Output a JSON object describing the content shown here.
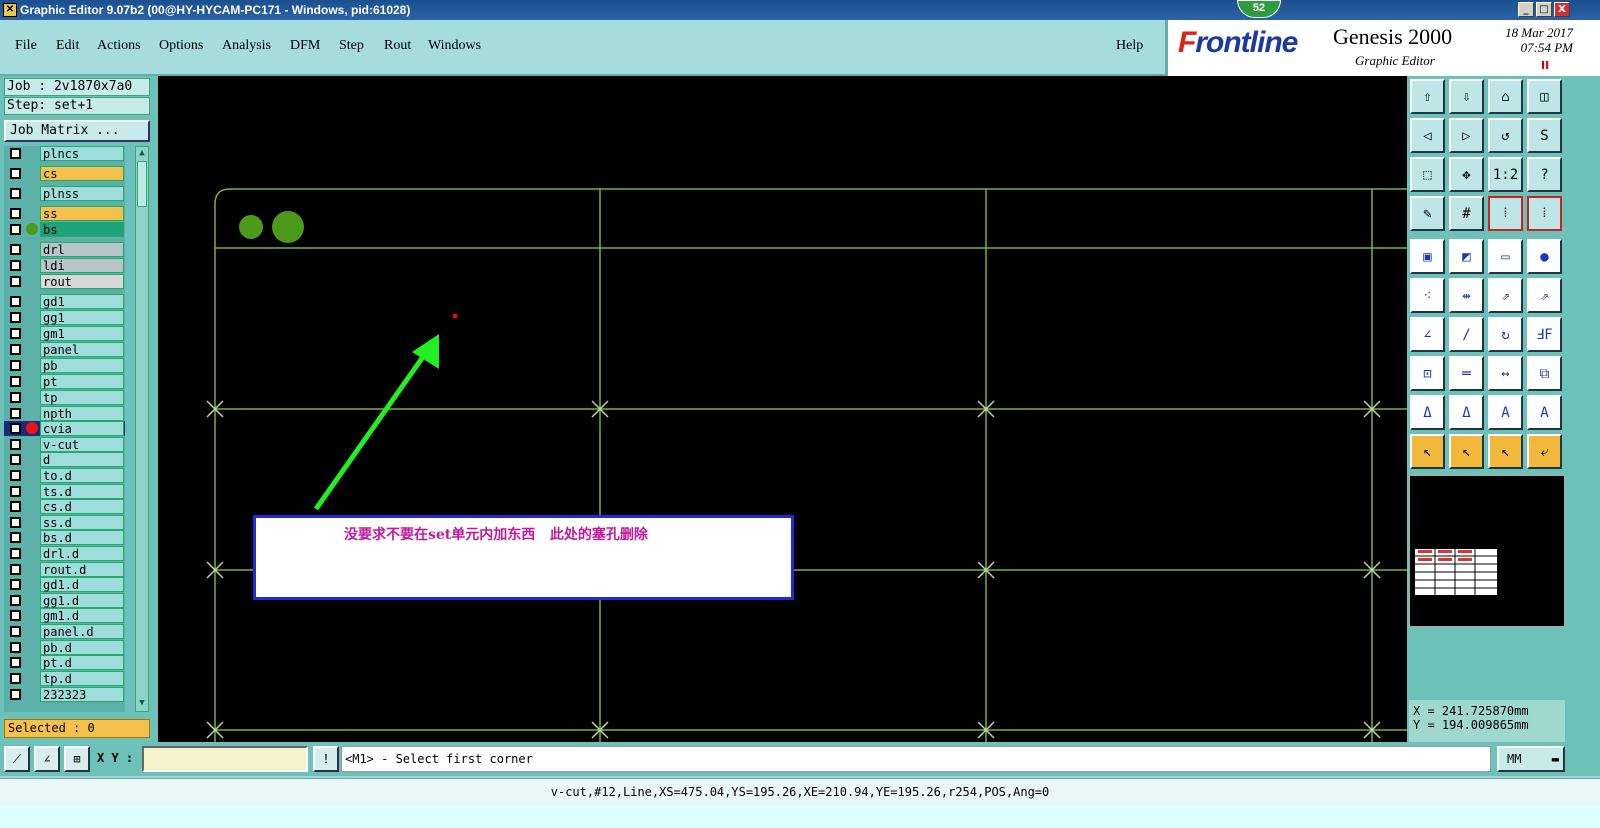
{
  "window": {
    "title": "Graphic Editor 9.07b2 (00@HY-HYCAM-PC171 - Windows, pid:61028)",
    "badge": "52",
    "controls": [
      "_",
      "□",
      "X"
    ]
  },
  "menu": {
    "items": [
      "File",
      "Edit",
      "Actions",
      "Options",
      "Analysis",
      "DFM",
      "Step",
      "Rout",
      "Windows"
    ],
    "help": "Help"
  },
  "brand": {
    "logo_f": "F",
    "logo_rest": "rontline",
    "product": "Genesis 2000",
    "subtitle": "Graphic Editor",
    "date": "18 Mar 2017",
    "time": "07:54 PM",
    "marker": "II"
  },
  "job": {
    "job_line": "Job : 2v1870x7a0",
    "step_line": "Step: set+1",
    "matrix_button": "Job Matrix ..."
  },
  "layers": [
    {
      "name": "plncs",
      "color": "#9fdcdc",
      "dot": null,
      "sel": false
    },
    {
      "name": "cs",
      "color": "#f6c04c",
      "dot": null,
      "sel": false
    },
    {
      "name": "plnss",
      "color": "#9fdcdc",
      "dot": null,
      "sel": false
    },
    {
      "name": "ss",
      "color": "#f6c04c",
      "dot": null,
      "sel": false
    },
    {
      "name": "bs",
      "color": "#1fa27a",
      "dot": "#4c9a1a",
      "sel": false
    },
    {
      "name": "drl",
      "color": "#b7c4c8",
      "dot": null,
      "sel": false
    },
    {
      "name": "ldi",
      "color": "#b7c4c8",
      "dot": null,
      "sel": false
    },
    {
      "name": "rout",
      "color": "#d8d8d8",
      "dot": null,
      "sel": false
    },
    {
      "name": "gd1",
      "color": "#9fdcdc",
      "dot": null,
      "sel": false
    },
    {
      "name": "gg1",
      "color": "#9fdcdc",
      "dot": null,
      "sel": false
    },
    {
      "name": "gm1",
      "color": "#9fdcdc",
      "dot": null,
      "sel": false
    },
    {
      "name": "panel",
      "color": "#9fdcdc",
      "dot": null,
      "sel": false
    },
    {
      "name": "pb",
      "color": "#9fdcdc",
      "dot": null,
      "sel": false
    },
    {
      "name": "pt",
      "color": "#9fdcdc",
      "dot": null,
      "sel": false
    },
    {
      "name": "tp",
      "color": "#9fdcdc",
      "dot": null,
      "sel": false
    },
    {
      "name": "npth",
      "color": "#9fdcdc",
      "dot": null,
      "sel": false
    },
    {
      "name": "cvia",
      "color": "#9fdcdc",
      "dot": "#ee1111",
      "sel": true
    },
    {
      "name": "v-cut",
      "color": "#9fdcdc",
      "dot": null,
      "sel": false
    },
    {
      "name": "d",
      "color": "#9fdcdc",
      "dot": null,
      "sel": false
    },
    {
      "name": "to.d",
      "color": "#9fdcdc",
      "dot": null,
      "sel": false
    },
    {
      "name": "ts.d",
      "color": "#9fdcdc",
      "dot": null,
      "sel": false
    },
    {
      "name": "cs.d",
      "color": "#9fdcdc",
      "dot": null,
      "sel": false
    },
    {
      "name": "ss.d",
      "color": "#9fdcdc",
      "dot": null,
      "sel": false
    },
    {
      "name": "bs.d",
      "color": "#9fdcdc",
      "dot": null,
      "sel": false
    },
    {
      "name": "drl.d",
      "color": "#9fdcdc",
      "dot": null,
      "sel": false
    },
    {
      "name": "rout.d",
      "color": "#9fdcdc",
      "dot": null,
      "sel": false
    },
    {
      "name": "gd1.d",
      "color": "#9fdcdc",
      "dot": null,
      "sel": false
    },
    {
      "name": "gg1.d",
      "color": "#9fdcdc",
      "dot": null,
      "sel": false
    },
    {
      "name": "gm1.d",
      "color": "#9fdcdc",
      "dot": null,
      "sel": false
    },
    {
      "name": "panel.d",
      "color": "#9fdcdc",
      "dot": null,
      "sel": false
    },
    {
      "name": "pb.d",
      "color": "#9fdcdc",
      "dot": null,
      "sel": false
    },
    {
      "name": "pt.d",
      "color": "#9fdcdc",
      "dot": null,
      "sel": false
    },
    {
      "name": "tp.d",
      "color": "#9fdcdc",
      "dot": null,
      "sel": false
    },
    {
      "name": "232323",
      "color": "#9fdcdc",
      "dot": null,
      "sel": false
    }
  ],
  "selected": "Selected : 0",
  "annotation": "没要求不要在set单元内加东西   此处的塞孔删除",
  "coords": {
    "x": "X = 241.725870mm",
    "y": "Y = 194.009865mm"
  },
  "command": {
    "xy_label": "X Y :",
    "xy_value": "",
    "warn": "!",
    "prompt": "<M1> - Select first corner",
    "units": "MM"
  },
  "status": "v-cut,#12,Line,XS=475.04,YS=195.26,XE=210.94,YE=195.26,r254,POS,Ang=0",
  "tools": {
    "row_icons": [
      [
        "step-up-icon",
        "step-down-icon",
        "home-icon",
        "split-view-icon"
      ],
      [
        "pan-left-icon",
        "pan-right-icon",
        "rotate-icon",
        "s-icon"
      ],
      [
        "zoom-fit-icon",
        "zoom-center-icon",
        "ratio-icon",
        "help-icon"
      ],
      [
        "grid-tools-icon",
        "grid-icon",
        "layers-red-icon",
        "layers-red2-icon"
      ],
      [
        "pad-icon",
        "shape-icon",
        "ruler-icon",
        "circle-icon"
      ],
      [
        "node-icon",
        "cross-icon",
        "point-icon",
        "point2-icon"
      ],
      [
        "angle-icon",
        "line-icon",
        "arc-icon",
        "mirror-icon"
      ],
      [
        "move-icon",
        "segment-icon",
        "gap-icon",
        "dup-icon"
      ],
      [
        "a-tri-icon",
        "a-tri2-icon",
        "a-tri3-icon",
        "a-tri4-icon"
      ],
      [
        "cursor-icon",
        "cursor-box-icon",
        "cursor-circle-icon",
        "cursor-route-icon"
      ]
    ],
    "labels": [
      "⇧",
      "⇩",
      "⌂",
      "◫",
      "◁",
      "▷",
      "↺",
      "S",
      "⬚",
      "✥",
      "1:2",
      "?",
      "✎",
      "#",
      "⁞",
      "⁞",
      "▣",
      "◩",
      "▭",
      "●",
      "⁖",
      "⇹",
      "⇗",
      "⇗",
      "∠",
      "/",
      "↻",
      "ℲF",
      "⊡",
      "═",
      "↔",
      "⧉",
      "Δ",
      "Δ",
      "A",
      "A",
      "↖",
      "↖",
      "↖",
      "⤶"
    ],
    "ratio_label": "1:2"
  }
}
